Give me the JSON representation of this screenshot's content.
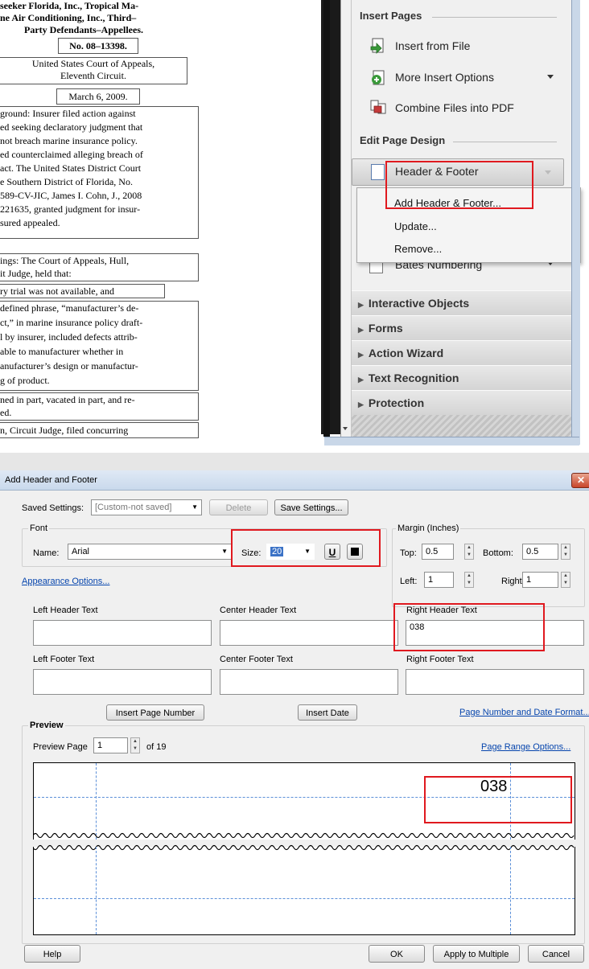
{
  "document": {
    "lines": [
      "seeker Florida, Inc., Tropical Ma-",
      "ne Air Conditioning, Inc., Third–",
      "Party Defendants–Appellees."
    ],
    "case_no": "No. 08–13398.",
    "court_line1": "United States Court of Appeals,",
    "court_line2": "Eleventh Circuit.",
    "date": "March 6, 2009.",
    "background": [
      "ground: Insurer filed action against",
      "ed seeking declaratory judgment that",
      "not breach marine insurance policy.",
      "ed counterclaimed alleging breach of",
      "act. The United States District Court",
      "e Southern District of Florida, No.",
      "589-CV-JIC, James I. Cohn, J., 2008",
      "221635, granted judgment for insur-",
      "sured appealed."
    ],
    "holdings": [
      "ings: The Court of Appeals, Hull,",
      "it Judge, held that:"
    ],
    "holding1": "ry trial was not available, and",
    "holding2": [
      "defined phrase, “manufacturer’s de-",
      "ct,” in marine insurance policy draft-",
      "l by insurer, included defects attrib-",
      "able to manufacturer whether in",
      "anufacturer’s design or manufactur-",
      "g of product."
    ],
    "disposition": [
      "ned in part, vacated in part, and re-",
      "ed."
    ],
    "concur": "n, Circuit Judge, filed concurring"
  },
  "panel": {
    "insert_pages_title": "Insert Pages",
    "insert_from_file": "Insert from File",
    "more_insert_options": "More Insert Options",
    "combine_files": "Combine Files into PDF",
    "edit_page_design_title": "Edit Page Design",
    "header_footer": "Header & Footer",
    "bates_numbering": "Bates Numbering",
    "menu": {
      "add": "Add Header & Footer...",
      "update": "Update...",
      "remove": "Remove..."
    },
    "sections": [
      "Interactive Objects",
      "Forms",
      "Action Wizard",
      "Text Recognition",
      "Protection"
    ]
  },
  "dialog": {
    "title": "Add Header and Footer",
    "saved_settings_label": "Saved Settings:",
    "saved_settings_value": "[Custom-not saved]",
    "delete_btn": "Delete",
    "save_settings_btn": "Save Settings...",
    "font_group": "Font",
    "name_label": "Name:",
    "font_name": "Arial",
    "size_label": "Size:",
    "size_value": "20",
    "underline_label": "U",
    "margin_group": "Margin (Inches)",
    "top_label": "Top:",
    "top_value": "0.5",
    "bottom_label": "Bottom:",
    "bottom_value": "0.5",
    "left_label": "Left:",
    "left_value": "1",
    "right_label": "Right:",
    "right_value": "1",
    "appearance_options": "Appearance Options...",
    "left_header_label": "Left Header Text",
    "center_header_label": "Center Header Text",
    "right_header_label": "Right Header Text",
    "right_header_value": "038",
    "left_footer_label": "Left Footer Text",
    "center_footer_label": "Center Footer Text",
    "right_footer_label": "Right Footer Text",
    "insert_page_number": "Insert Page Number",
    "insert_date": "Insert Date",
    "page_number_format": "Page Number and Date Format...",
    "preview_group": "Preview",
    "preview_page_label": "Preview Page",
    "preview_page_value": "1",
    "of_pages": "of 19",
    "page_range_options": "Page Range Options...",
    "preview_header_text": "038",
    "help_btn": "Help",
    "ok_btn": "OK",
    "apply_multiple_btn": "Apply to Multiple",
    "cancel_btn": "Cancel",
    "colors": {
      "highlight": "#e0191f",
      "link": "#0645ad",
      "guide": "#5b8fd8"
    }
  }
}
